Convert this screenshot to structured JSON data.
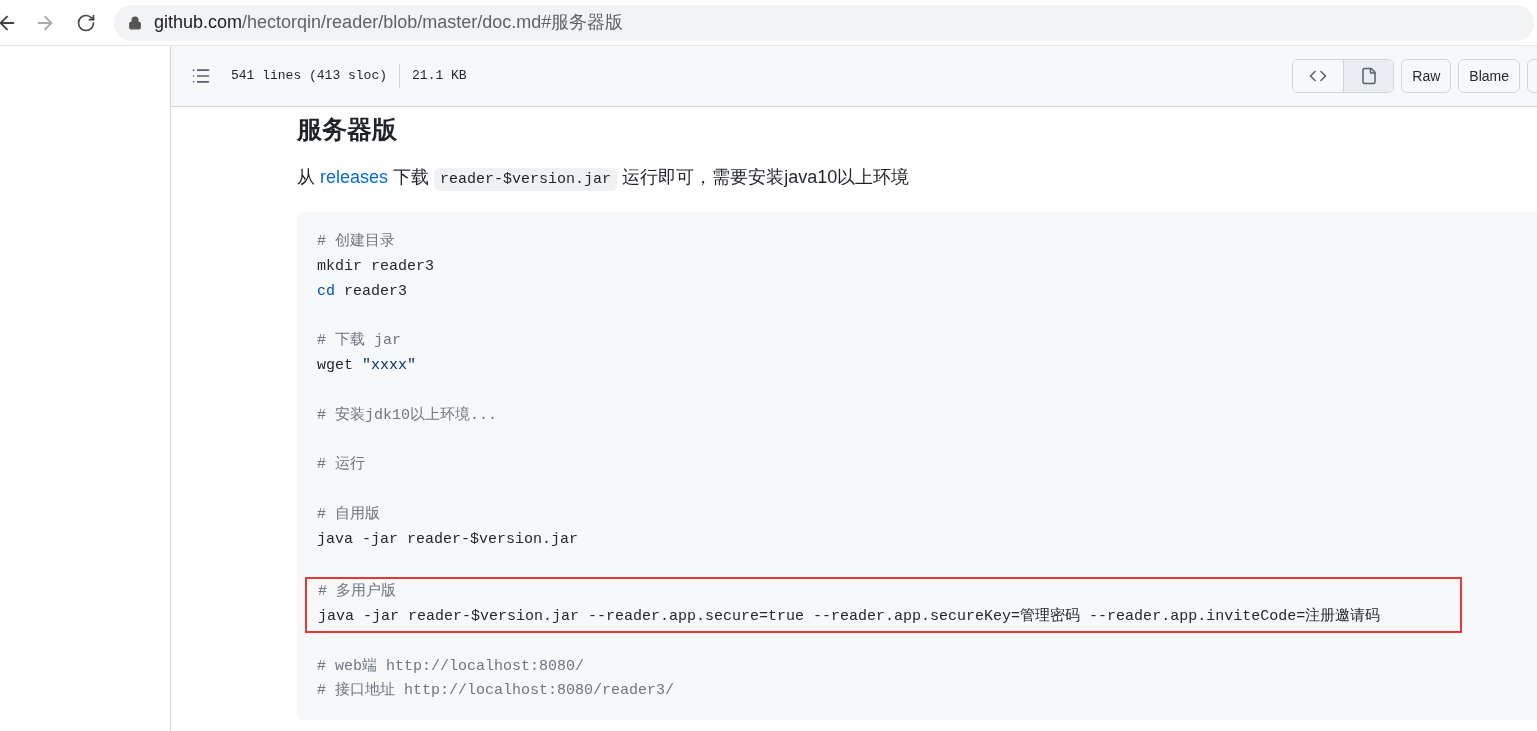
{
  "browser": {
    "url_host": "github.com",
    "url_path": "/hectorqin/reader/blob/master/doc.md#服务器版"
  },
  "file_header": {
    "lines": "541 lines (413 sloc)",
    "size": "21.1 KB",
    "view_modes": [
      {
        "kind": "code",
        "selected": false
      },
      {
        "kind": "preview",
        "selected": true
      }
    ],
    "buttons": [
      "Raw",
      "Blame"
    ]
  },
  "heading": "服务器版",
  "intro": {
    "before": "从",
    "link": "releases",
    "middle": "下载",
    "code": "reader-$version.jar",
    "after": "运行即可，需要安装java10以上环境"
  },
  "code_blocks": [
    {
      "highlighted": false,
      "lines": [
        [
          {
            "kind": "comment",
            "text": "# 创建目录"
          }
        ],
        [
          {
            "kind": "plain",
            "text": "mkdir reader3"
          }
        ],
        [
          {
            "kind": "builtin",
            "text": "cd"
          },
          {
            "kind": "plain",
            "text": " reader3"
          }
        ]
      ]
    },
    {
      "highlighted": false,
      "lines": [
        [
          {
            "kind": "comment",
            "text": "# 下载 jar"
          }
        ],
        [
          {
            "kind": "plain",
            "text": "wget "
          },
          {
            "kind": "string",
            "text": "\"xxxx\""
          }
        ]
      ]
    },
    {
      "highlighted": false,
      "lines": [
        [
          {
            "kind": "comment",
            "text": "# 安装jdk10以上环境..."
          }
        ]
      ]
    },
    {
      "highlighted": false,
      "lines": [
        [
          {
            "kind": "comment",
            "text": "# 运行"
          }
        ]
      ]
    },
    {
      "highlighted": false,
      "lines": [
        [
          {
            "kind": "comment",
            "text": "# 自用版"
          }
        ],
        [
          {
            "kind": "plain",
            "text": "java -jar reader-$version.jar"
          }
        ]
      ]
    },
    {
      "highlighted": true,
      "lines": [
        [
          {
            "kind": "comment",
            "text": "# 多用户版"
          }
        ],
        [
          {
            "kind": "plain",
            "text": "java -jar reader-$version.jar --reader.app.secure=true --reader.app.secureKey=管理密码 --reader.app.inviteCode=注册邀请码"
          }
        ]
      ]
    },
    {
      "highlighted": false,
      "lines": [
        [
          {
            "kind": "comment",
            "text": "# web端 http://localhost:8080/"
          }
        ],
        [
          {
            "kind": "comment",
            "text": "# 接口地址 http://localhost:8080/reader3/"
          }
        ]
      ]
    }
  ]
}
